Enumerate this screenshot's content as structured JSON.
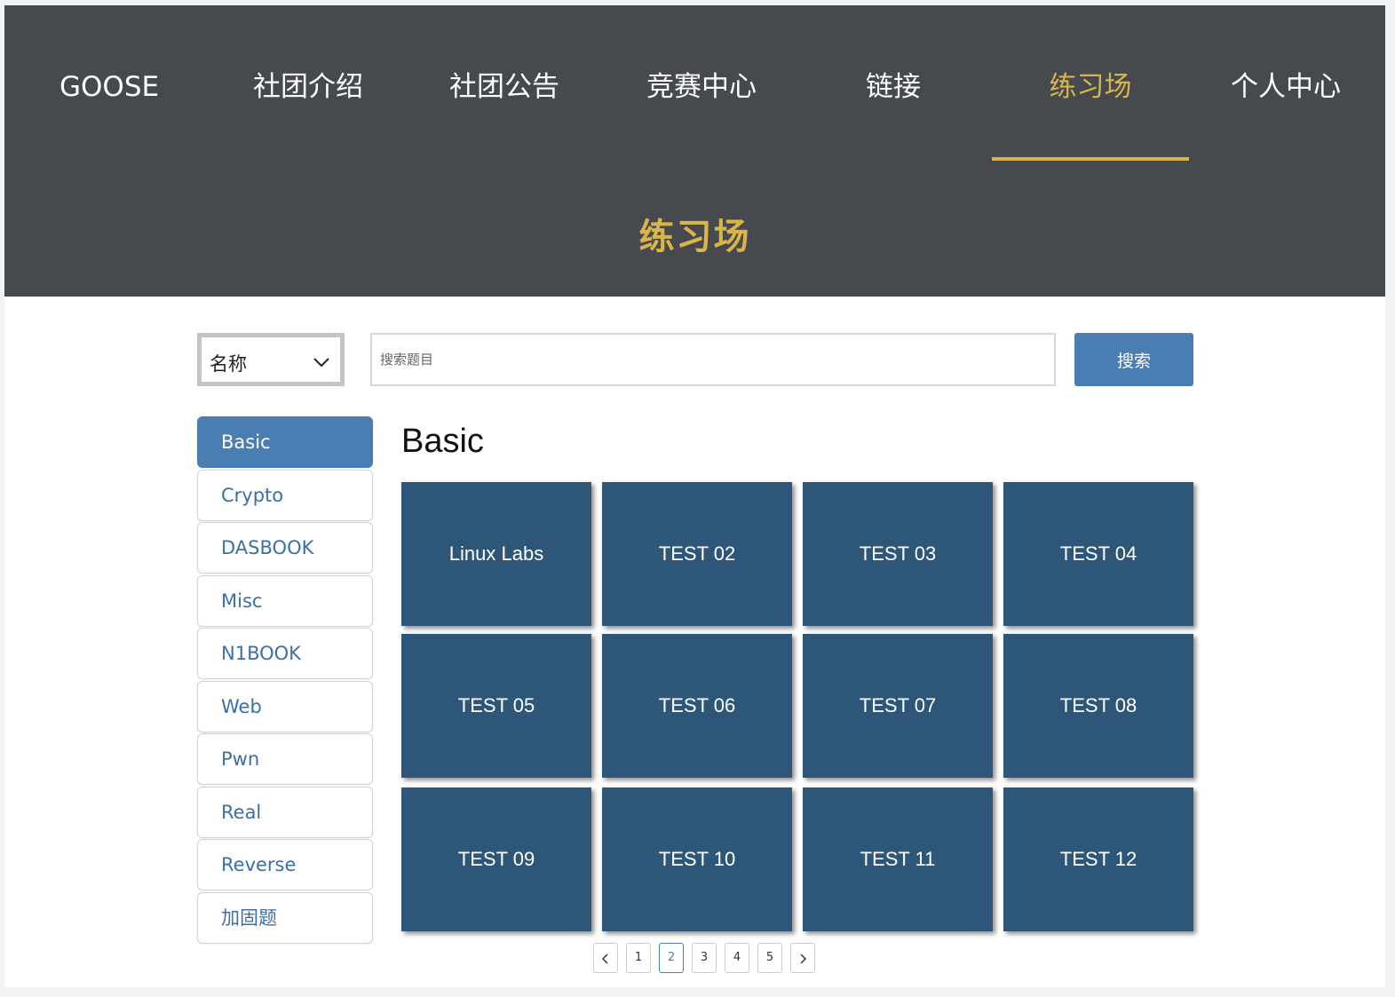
{
  "nav": {
    "brand": "GOOSE",
    "items": [
      {
        "label": "社团介绍"
      },
      {
        "label": "社团公告"
      },
      {
        "label": "竞赛中心"
      },
      {
        "label": "链接"
      },
      {
        "label": "练习场"
      },
      {
        "label": "个人中心"
      }
    ],
    "active": "练习场"
  },
  "header": {
    "title": "练习场"
  },
  "search": {
    "select_value": "名称",
    "placeholder": "搜索题目",
    "button_label": "搜索"
  },
  "sidebar": {
    "items": [
      {
        "label": "Basic"
      },
      {
        "label": "Crypto"
      },
      {
        "label": "DASBOOK"
      },
      {
        "label": "Misc"
      },
      {
        "label": "N1BOOK"
      },
      {
        "label": "Web"
      },
      {
        "label": "Pwn"
      },
      {
        "label": "Real"
      },
      {
        "label": "Reverse"
      },
      {
        "label": "加固题"
      }
    ],
    "active": "Basic"
  },
  "main": {
    "section_title": "Basic",
    "tiles": [
      {
        "label": "Linux Labs"
      },
      {
        "label": "TEST 02"
      },
      {
        "label": "TEST 03"
      },
      {
        "label": "TEST 04"
      },
      {
        "label": "TEST 05"
      },
      {
        "label": "TEST 06"
      },
      {
        "label": "TEST 07"
      },
      {
        "label": "TEST 08"
      },
      {
        "label": "TEST 09"
      },
      {
        "label": "TEST 10"
      },
      {
        "label": "TEST 11"
      },
      {
        "label": "TEST 12"
      }
    ]
  },
  "pagination": {
    "pages": [
      "1",
      "2",
      "3",
      "4",
      "5"
    ],
    "current": "2",
    "prev_icon": "chevron-left-icon",
    "next_icon": "chevron-right-icon"
  },
  "colors": {
    "header_bg": "#46494d",
    "accent_gold": "#d9b449",
    "primary_blue": "#4a7db1",
    "tile_bg": "#2e5679"
  }
}
